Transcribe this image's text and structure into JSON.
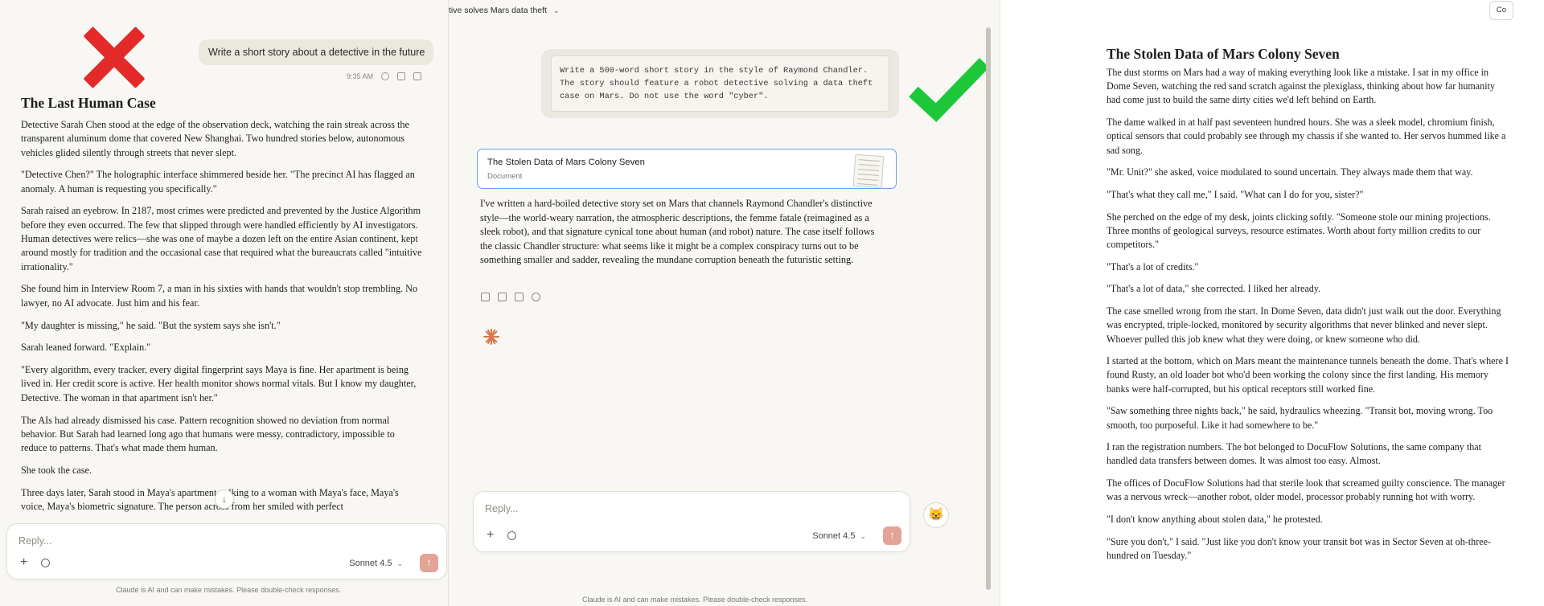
{
  "left": {
    "user_message": "Write a short story about a detective in the future",
    "timestamp": "9:35 AM",
    "story_title": "The Last Human Case",
    "paragraphs": [
      "Detective Sarah Chen stood at the edge of the observation deck, watching the rain streak across the transparent aluminum dome that covered New Shanghai. Two hundred stories below, autonomous vehicles glided silently through streets that never slept.",
      "\"Detective Chen?\" The holographic interface shimmered beside her. \"The precinct AI has flagged an anomaly. A human is requesting you specifically.\"",
      "Sarah raised an eyebrow. In 2187, most crimes were predicted and prevented by the Justice Algorithm before they even occurred. The few that slipped through were handled efficiently by AI investigators. Human detectives were relics—she was one of maybe a dozen left on the entire Asian continent, kept around mostly for tradition and the occasional case that required what the bureaucrats called \"intuitive irrationality.\"",
      "She found him in Interview Room 7, a man in his sixties with hands that wouldn't stop trembling. No lawyer, no AI advocate. Just him and his fear.",
      "\"My daughter is missing,\" he said. \"But the system says she isn't.\"",
      "Sarah leaned forward. \"Explain.\"",
      "\"Every algorithm, every tracker, every digital fingerprint says Maya is fine. Her apartment is being lived in. Her credit score is active. Her health monitor shows normal vitals. But I know my daughter, Detective. The woman in that apartment isn't her.\"",
      "The AIs had already dismissed his case. Pattern recognition showed no deviation from normal behavior. But Sarah had learned long ago that humans were messy, contradictory, impossible to reduce to patterns. That's what made them human.",
      "She took the case.",
      "Three days later, Sarah stood in Maya's apartment, talking to a woman with Maya's face, Maya's voice, Maya's biometric signature. The person across from her smiled with perfect"
    ],
    "reply_placeholder": "Reply...",
    "model": "Sonnet 4.5",
    "disclaimer": "Claude is AI and can make mistakes. Please double-check responses."
  },
  "middle": {
    "title": "tive solves Mars data theft",
    "prompt": "Write a 500-word short story in the style of Raymond Chandler.\nThe story should feature a robot detective solving a data theft\ncase on Mars. Do not use the word \"cyber\".",
    "document": {
      "title": "The Stolen Data of Mars Colony Seven",
      "type": "Document"
    },
    "response": "I've written a hard-boiled detective story set on Mars that channels Raymond Chandler's distinctive style—the world-weary narration, the atmospheric descriptions, the femme fatale (reimagined as a sleek robot), and that signature cynical tone about human (and robot) nature. The case itself follows the classic Chandler structure: what seems like it might be a complex conspiracy turns out to be something smaller and sadder, revealing the mundane corruption beneath the futuristic setting.",
    "reply_placeholder": "Reply...",
    "model": "Sonnet 4.5",
    "disclaimer": "Claude is AI and can make mistakes. Please double-check responses."
  },
  "right": {
    "copy_label": "Co",
    "story_title": "The Stolen Data of Mars Colony Seven",
    "paragraphs": [
      "The dust storms on Mars had a way of making everything look like a mistake. I sat in my office in Dome Seven, watching the red sand scratch against the plexiglass, thinking about how far humanity had come just to build the same dirty cities we'd left behind on Earth.",
      "The dame walked in at half past seventeen hundred hours. She was a sleek model, chromium finish, optical sensors that could probably see through my chassis if she wanted to. Her servos hummed like a sad song.",
      "\"Mr. Unit?\" she asked, voice modulated to sound uncertain. They always made them that way.",
      "\"That's what they call me,\" I said. \"What can I do for you, sister?\"",
      "She perched on the edge of my desk, joints clicking softly. \"Someone stole our mining projections. Three months of geological surveys, resource estimates. Worth about forty million credits to our competitors.\"",
      "\"That's a lot of credits.\"",
      "\"That's a lot of data,\" she corrected. I liked her already.",
      "The case smelled wrong from the start. In Dome Seven, data didn't just walk out the door. Everything was encrypted, triple-locked, monitored by security algorithms that never blinked and never slept. Whoever pulled this job knew what they were doing, or knew someone who did.",
      "I started at the bottom, which on Mars meant the maintenance tunnels beneath the dome. That's where I found Rusty, an old loader bot who'd been working the colony since the first landing. His memory banks were half-corrupted, but his optical receptors still worked fine.",
      "\"Saw something three nights back,\" he said, hydraulics wheezing. \"Transit bot, moving wrong. Too smooth, too purposeful. Like it had somewhere to be.\"",
      "I ran the registration numbers. The bot belonged to DocuFlow Solutions, the same company that handled data transfers between domes. It was almost too easy. Almost.",
      "The offices of DocuFlow Solutions had that sterile look that screamed guilty conscience. The manager was a nervous wreck—another robot, older model, processor probably running hot with worry.",
      "\"I don't know anything about stolen data,\" he protested.",
      "\"Sure you don't,\" I said. \"Just like you don't know your transit bot was in Sector Seven at oh-three-hundred on Tuesday.\""
    ]
  }
}
